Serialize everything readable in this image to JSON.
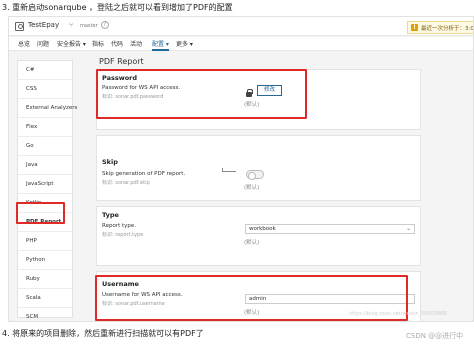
{
  "steps": {
    "top": "3. 重新启动sonarqube ，登陆之后就可以看到增加了PDF的配置",
    "bottom": "4. 将原来的项目删除，然后重新进行扫描就可以有PDF了"
  },
  "header": {
    "project_name": "TestEpay",
    "branch": "master",
    "branch_icon": "branch-icon",
    "help": "?",
    "notice_icon": "!",
    "notice": "最近一次分析于：3:0"
  },
  "nav": {
    "items": [
      "总览",
      "问题",
      "安全报告 ▾",
      "指标",
      "代码",
      "活动",
      "配置 ▾",
      "更多 ▾"
    ],
    "active_index": 6
  },
  "sidebar": {
    "items": [
      "C#",
      "CSS",
      "External Analyzers",
      "Flex",
      "Go",
      "Java",
      "JavaScript",
      "Kotlin",
      "PDF Report",
      "PHP",
      "Python",
      "Ruby",
      "Scala",
      "SCM"
    ],
    "selected": "PDF Report"
  },
  "main": {
    "title": "PDF Report",
    "password": {
      "title": "Password",
      "label": "Password for WS API access.",
      "key": "标识: sonar.pdf.password",
      "button": "修改",
      "default": "(默认)"
    },
    "skip": {
      "title": "Skip",
      "label": "Skip generation of PDF report.",
      "key": "标识: sonar.pdf.skip",
      "default": "(默认)"
    },
    "type": {
      "title": "Type",
      "label": "Report type.",
      "key": "标识: report.type",
      "value": "workbook",
      "default": "(默认)"
    },
    "username": {
      "title": "Username",
      "label": "Username for WS API access.",
      "key": "标识: sonar.pdf.username",
      "value": "admin",
      "default": "(默认)"
    }
  },
  "watermark": "https://blog.csdn.net/weixin_50603888",
  "footer": {
    "csdn": "CSDN @@进行中"
  },
  "colors": {
    "highlight": "#e02a2a",
    "accent": "#236a97",
    "notice_bg": "#fcf8e3"
  }
}
